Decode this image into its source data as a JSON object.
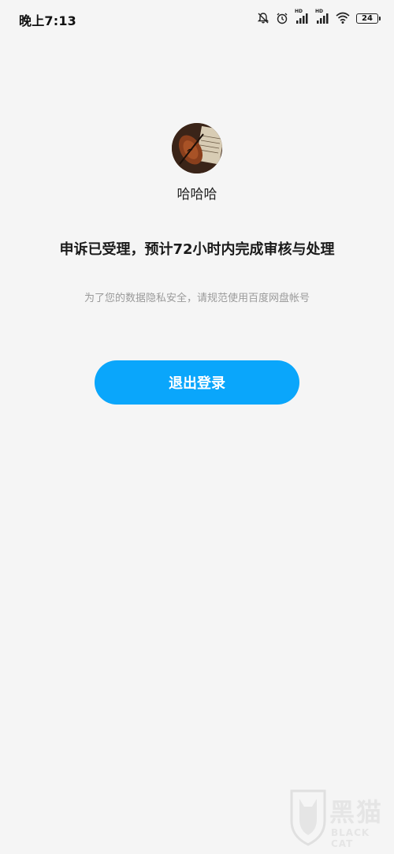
{
  "status_bar": {
    "time": "晚上7:13",
    "icons": [
      "bell-off-icon",
      "alarm-icon",
      "signal-hd-icon",
      "signal-hd-icon",
      "wifi-icon"
    ],
    "battery_level": "24"
  },
  "profile": {
    "avatar": "violin-avatar",
    "username": "哈哈哈"
  },
  "message": {
    "headline": "申诉已受理，预计72小时内完成审核与处理",
    "subline": "为了您的数据隐私安全，请规范使用百度网盘帐号"
  },
  "actions": {
    "logout_label": "退出登录"
  },
  "watermark": {
    "cn": "黑猫",
    "en": "BLACK CAT"
  },
  "colors": {
    "background": "#f5f5f5",
    "primary_button": "#0aa6fb",
    "subtext": "#9a9a9a"
  }
}
